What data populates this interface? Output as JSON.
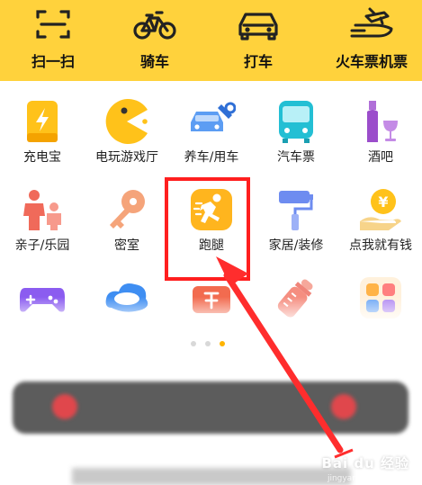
{
  "top_bar": {
    "items": [
      {
        "label": "扫一扫",
        "icon": "scan-icon"
      },
      {
        "label": "骑车",
        "icon": "bicycle-icon"
      },
      {
        "label": "打车",
        "icon": "car-icon"
      },
      {
        "label": "火车票机票",
        "icon": "train-plane-icon"
      }
    ],
    "color": "#FFD23C"
  },
  "grid": {
    "rows": [
      [
        {
          "label": "充电宝",
          "icon": "power-bank-icon"
        },
        {
          "label": "电玩游戏厅",
          "icon": "pacman-icon"
        },
        {
          "label": "养车/用车",
          "icon": "car-wrench-icon"
        },
        {
          "label": "汽车票",
          "icon": "bus-icon"
        },
        {
          "label": "酒吧",
          "icon": "wine-icon"
        }
      ],
      [
        {
          "label": "亲子/乐园",
          "icon": "family-icon"
        },
        {
          "label": "密室",
          "icon": "key-icon"
        },
        {
          "label": "跑腿",
          "icon": "running-errand-icon"
        },
        {
          "label": "家居/装修",
          "icon": "paint-roller-icon"
        },
        {
          "label": "点我就有钱",
          "icon": "coin-hand-icon"
        }
      ],
      [
        {
          "label": "",
          "icon": "gamepad-icon"
        },
        {
          "label": "",
          "icon": "cloud-icon"
        },
        {
          "label": "",
          "icon": "ticket-icon"
        },
        {
          "label": "",
          "icon": "baby-bottle-icon"
        },
        {
          "label": "",
          "icon": "apps-icon"
        }
      ]
    ]
  },
  "pager": {
    "count": 3,
    "active_index": 2,
    "active_color": "#FFB400"
  },
  "annotation": {
    "highlight_color": "#ff1f1f",
    "target": "跑腿"
  },
  "watermark": {
    "text": "Bai du 经验",
    "sub": "jingyan.baidu.com"
  }
}
